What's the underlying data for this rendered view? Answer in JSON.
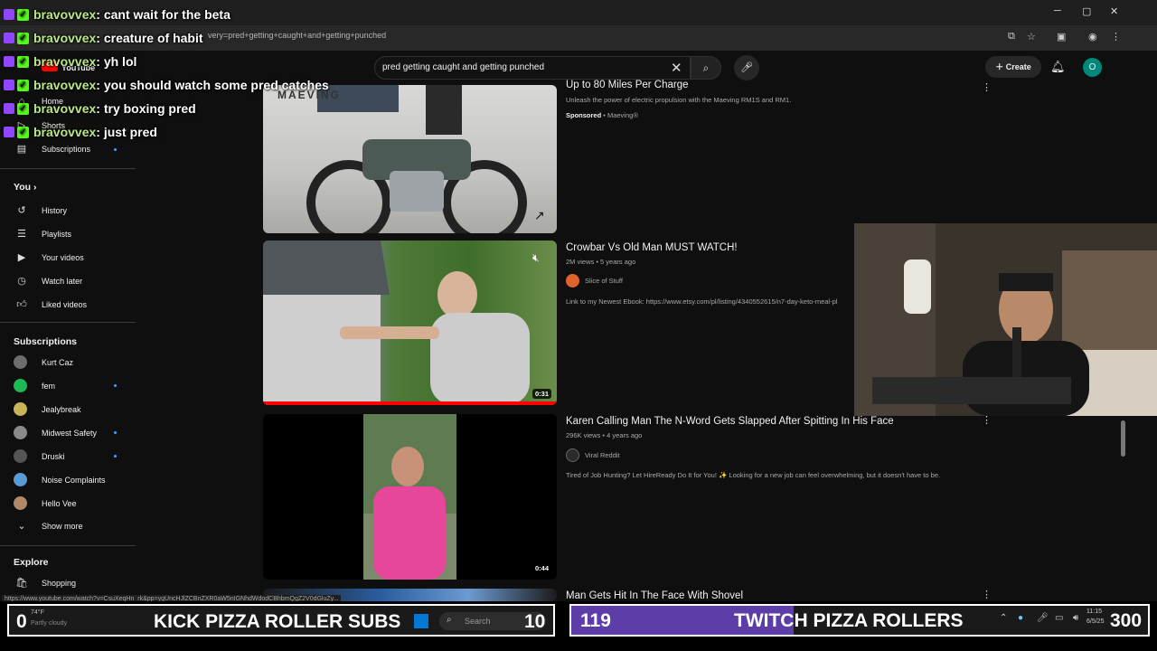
{
  "browser": {
    "url": "very=pred+getting+caught+and+getting+punched",
    "status_url": "https://www.youtube.com/watch?v=CsuXeqHn_rk&pp=ygUncHJlZCBnZXR0aW5nIGNhdWdodCBhbmQgZ2V0dGluZy..."
  },
  "header": {
    "logo": "YouTube",
    "search_query": "pred getting caught and getting punched",
    "create_label": "Create",
    "avatar_letter": "O"
  },
  "sidebar": {
    "main": [
      {
        "label": "Home",
        "icon": "home-icon"
      },
      {
        "label": "Shorts",
        "icon": "shorts-icon"
      },
      {
        "label": "Subscriptions",
        "icon": "subscriptions-icon"
      }
    ],
    "you_heading": "You",
    "you_items": [
      {
        "label": "History",
        "icon": "history-icon"
      },
      {
        "label": "Playlists",
        "icon": "playlists-icon"
      },
      {
        "label": "Your videos",
        "icon": "your-videos-icon"
      },
      {
        "label": "Watch later",
        "icon": "watch-later-icon"
      },
      {
        "label": "Liked videos",
        "icon": "liked-videos-icon"
      }
    ],
    "subs_heading": "Subscriptions",
    "subscriptions": [
      {
        "label": "Kurt Caz",
        "color": "#6d6d6d"
      },
      {
        "label": "fem",
        "color": "#1db954"
      },
      {
        "label": "Jealybreak",
        "color": "#c9b458"
      },
      {
        "label": "Midwest Safety",
        "color": "#8a8a8a"
      },
      {
        "label": "Druski",
        "color": "#555555"
      },
      {
        "label": "Noise Complaints",
        "color": "#5a9bd4"
      },
      {
        "label": "Hello Vee",
        "color": "#b08968"
      }
    ],
    "show_more": "Show more",
    "explore_heading": "Explore",
    "explore_items": [
      {
        "label": "Shopping",
        "icon": "shopping-icon"
      }
    ]
  },
  "results": [
    {
      "title": "Up to 80 Miles Per Charge",
      "desc": "Unleash the power of electric propulsion with the Maeving RM1S and RM1.",
      "sponsored": "Sponsored",
      "channel": "Maeving®",
      "thumb_brand": "MAEVING"
    },
    {
      "title": "Crowbar Vs Old Man MUST WATCH!",
      "meta": "2M views • 5 years ago",
      "channel": "Slice of Stuff",
      "desc": "Link to my Newest Ebook: https://www.etsy.com/pl/listing/4340552615/n7-day-keto-meal-pl",
      "duration": "0:31"
    },
    {
      "title": "Karen Calling Man The N-Word Gets Slapped After Spitting In His Face",
      "meta": "296K views • 4 years ago",
      "channel": "Viral Reddit",
      "desc": "Tired of Job Hunting? Let HireReady Do It for You! ✨ Looking for a new job can feel overwhelming, but it doesn't have to be.",
      "duration": "0:44"
    },
    {
      "title": "Man Gets Hit In The Face With Shovel"
    }
  ],
  "chat": [
    {
      "user": "bravovvex",
      "msg": " : cant wait for the beta"
    },
    {
      "user": "bravovvex",
      "msg": " : creature of habit"
    },
    {
      "user": "bravovvex",
      "msg": " : yh lol"
    },
    {
      "user": "bravovvex",
      "msg": " : you should watch some pred catches"
    },
    {
      "user": "bravovvex",
      "msg": " : try boxing pred"
    },
    {
      "user": "bravovvex",
      "msg": " : just pred"
    }
  ],
  "overlay": {
    "kick_count": "0",
    "kick_label": "KICK PIZZA ROLLER SUBS",
    "kick_goal": "10",
    "twitch_count": "119",
    "twitch_label": "TWITCH PIZZA ROLLERS",
    "twitch_goal": "300",
    "weather_temp": "74°F",
    "weather_desc": "Partly cloudy",
    "taskbar_search": "Search",
    "time": "11:15",
    "date": "6/5/25"
  }
}
